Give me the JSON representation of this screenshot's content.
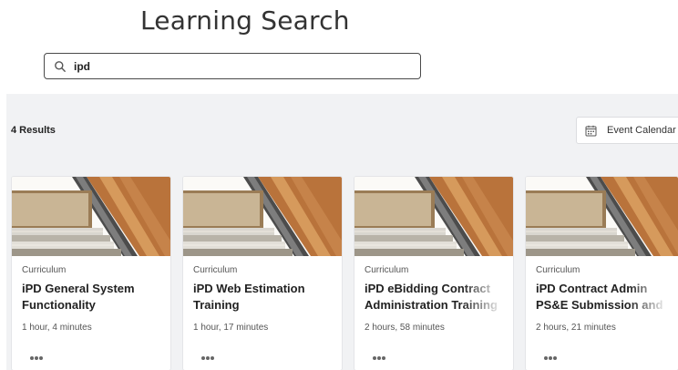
{
  "header": {
    "title": "Learning Search"
  },
  "search": {
    "value": "ipd",
    "icon": "search-icon"
  },
  "results": {
    "count_label": "4 Results",
    "calendar_button": {
      "label": "Event Calendar",
      "icon": "calendar-icon"
    }
  },
  "cards": [
    {
      "type": "Curriculum",
      "title": "iPD General System Functionality",
      "duration": "1 hour, 4 minutes"
    },
    {
      "type": "Curriculum",
      "title": "iPD Web Estimation Training",
      "duration": "1 hour, 17 minutes"
    },
    {
      "type": "Curriculum",
      "title": "iPD eBidding Contract Administration Training",
      "duration": "2 hours, 58 minutes"
    },
    {
      "type": "Curriculum",
      "title": "iPD Contract Admin PS&E Submission and",
      "duration": "2 hours, 21 minutes"
    }
  ],
  "colors": {
    "panel_background": "#f1f2f4",
    "card_background": "#ffffff",
    "text_primary": "#222222",
    "text_secondary": "#555555"
  }
}
